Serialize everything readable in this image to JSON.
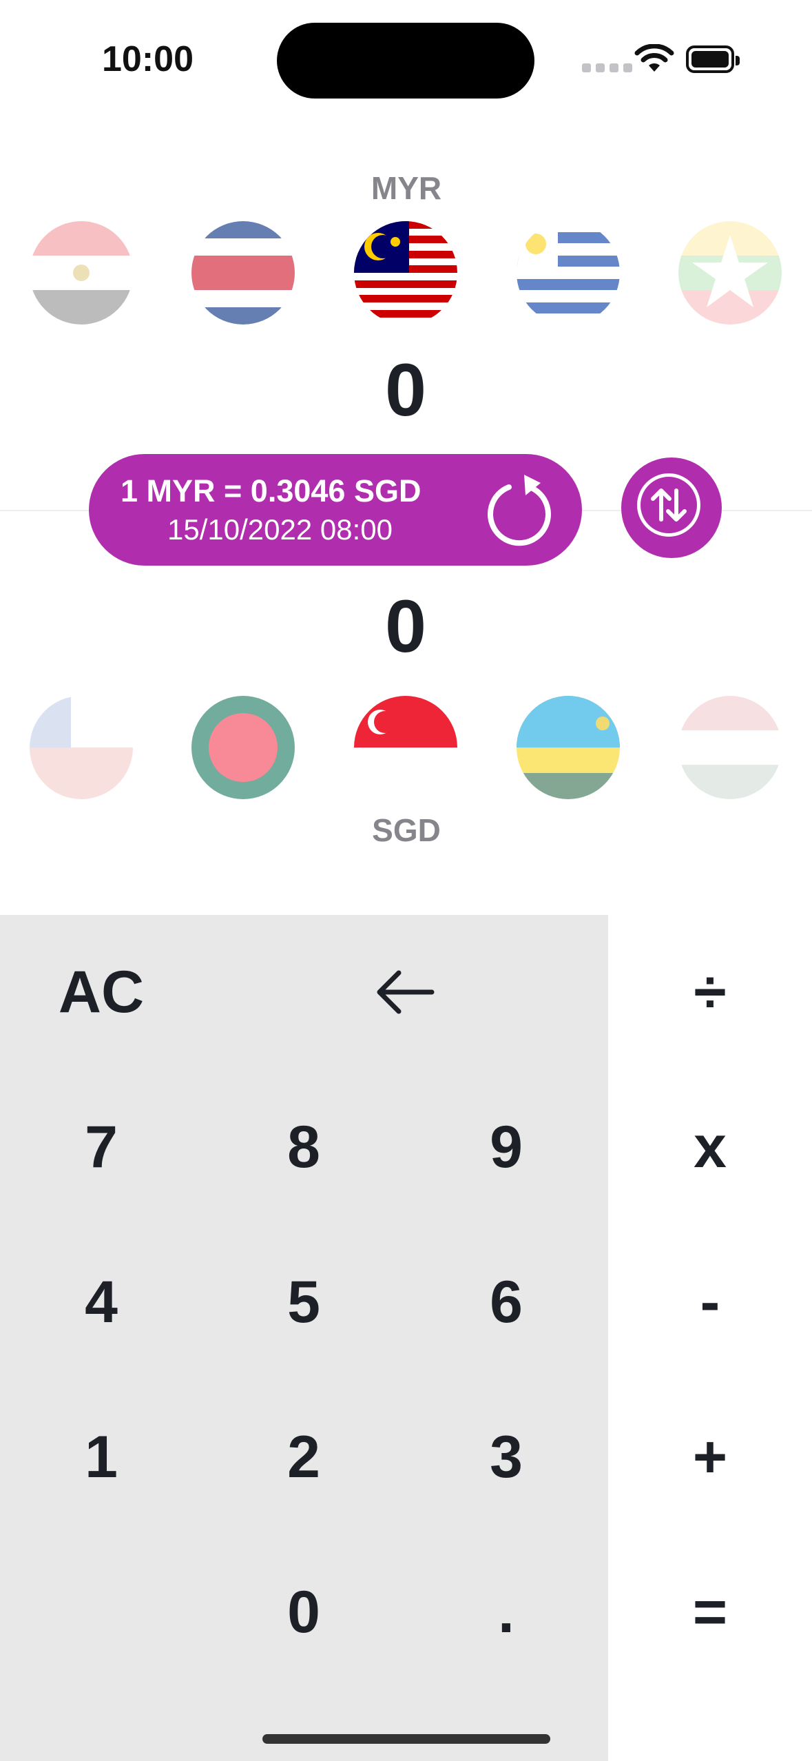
{
  "status_bar": {
    "time": "10:00"
  },
  "from": {
    "code": "MYR",
    "amount": "0",
    "flags": [
      "egypt-flag",
      "costa-rica-flag",
      "malaysia-flag",
      "uruguay-flag",
      "myanmar-flag"
    ],
    "selected_flag": "malaysia-flag"
  },
  "rate": {
    "text": "1 MYR = 0.3046 SGD",
    "timestamp": "15/10/2022 08:00"
  },
  "to": {
    "code": "SGD",
    "amount": "0",
    "flags": [
      "chile-flag",
      "bangladesh-flag",
      "singapore-flag",
      "rwanda-flag",
      "hungary-flag"
    ],
    "selected_flag": "singapore-flag"
  },
  "keypad": {
    "clear": "AC",
    "backspace_icon": "arrow-left-icon",
    "digits": [
      "7",
      "8",
      "9",
      "4",
      "5",
      "6",
      "1",
      "2",
      "3",
      "0",
      "."
    ],
    "ops": {
      "divide": "÷",
      "multiply": "x",
      "minus": "-",
      "plus": "+",
      "equals": "="
    }
  },
  "colors": {
    "accent": "#b02ead",
    "keypad_bg": "#e8e8e8",
    "text": "#1d2127",
    "muted": "#85858b"
  }
}
